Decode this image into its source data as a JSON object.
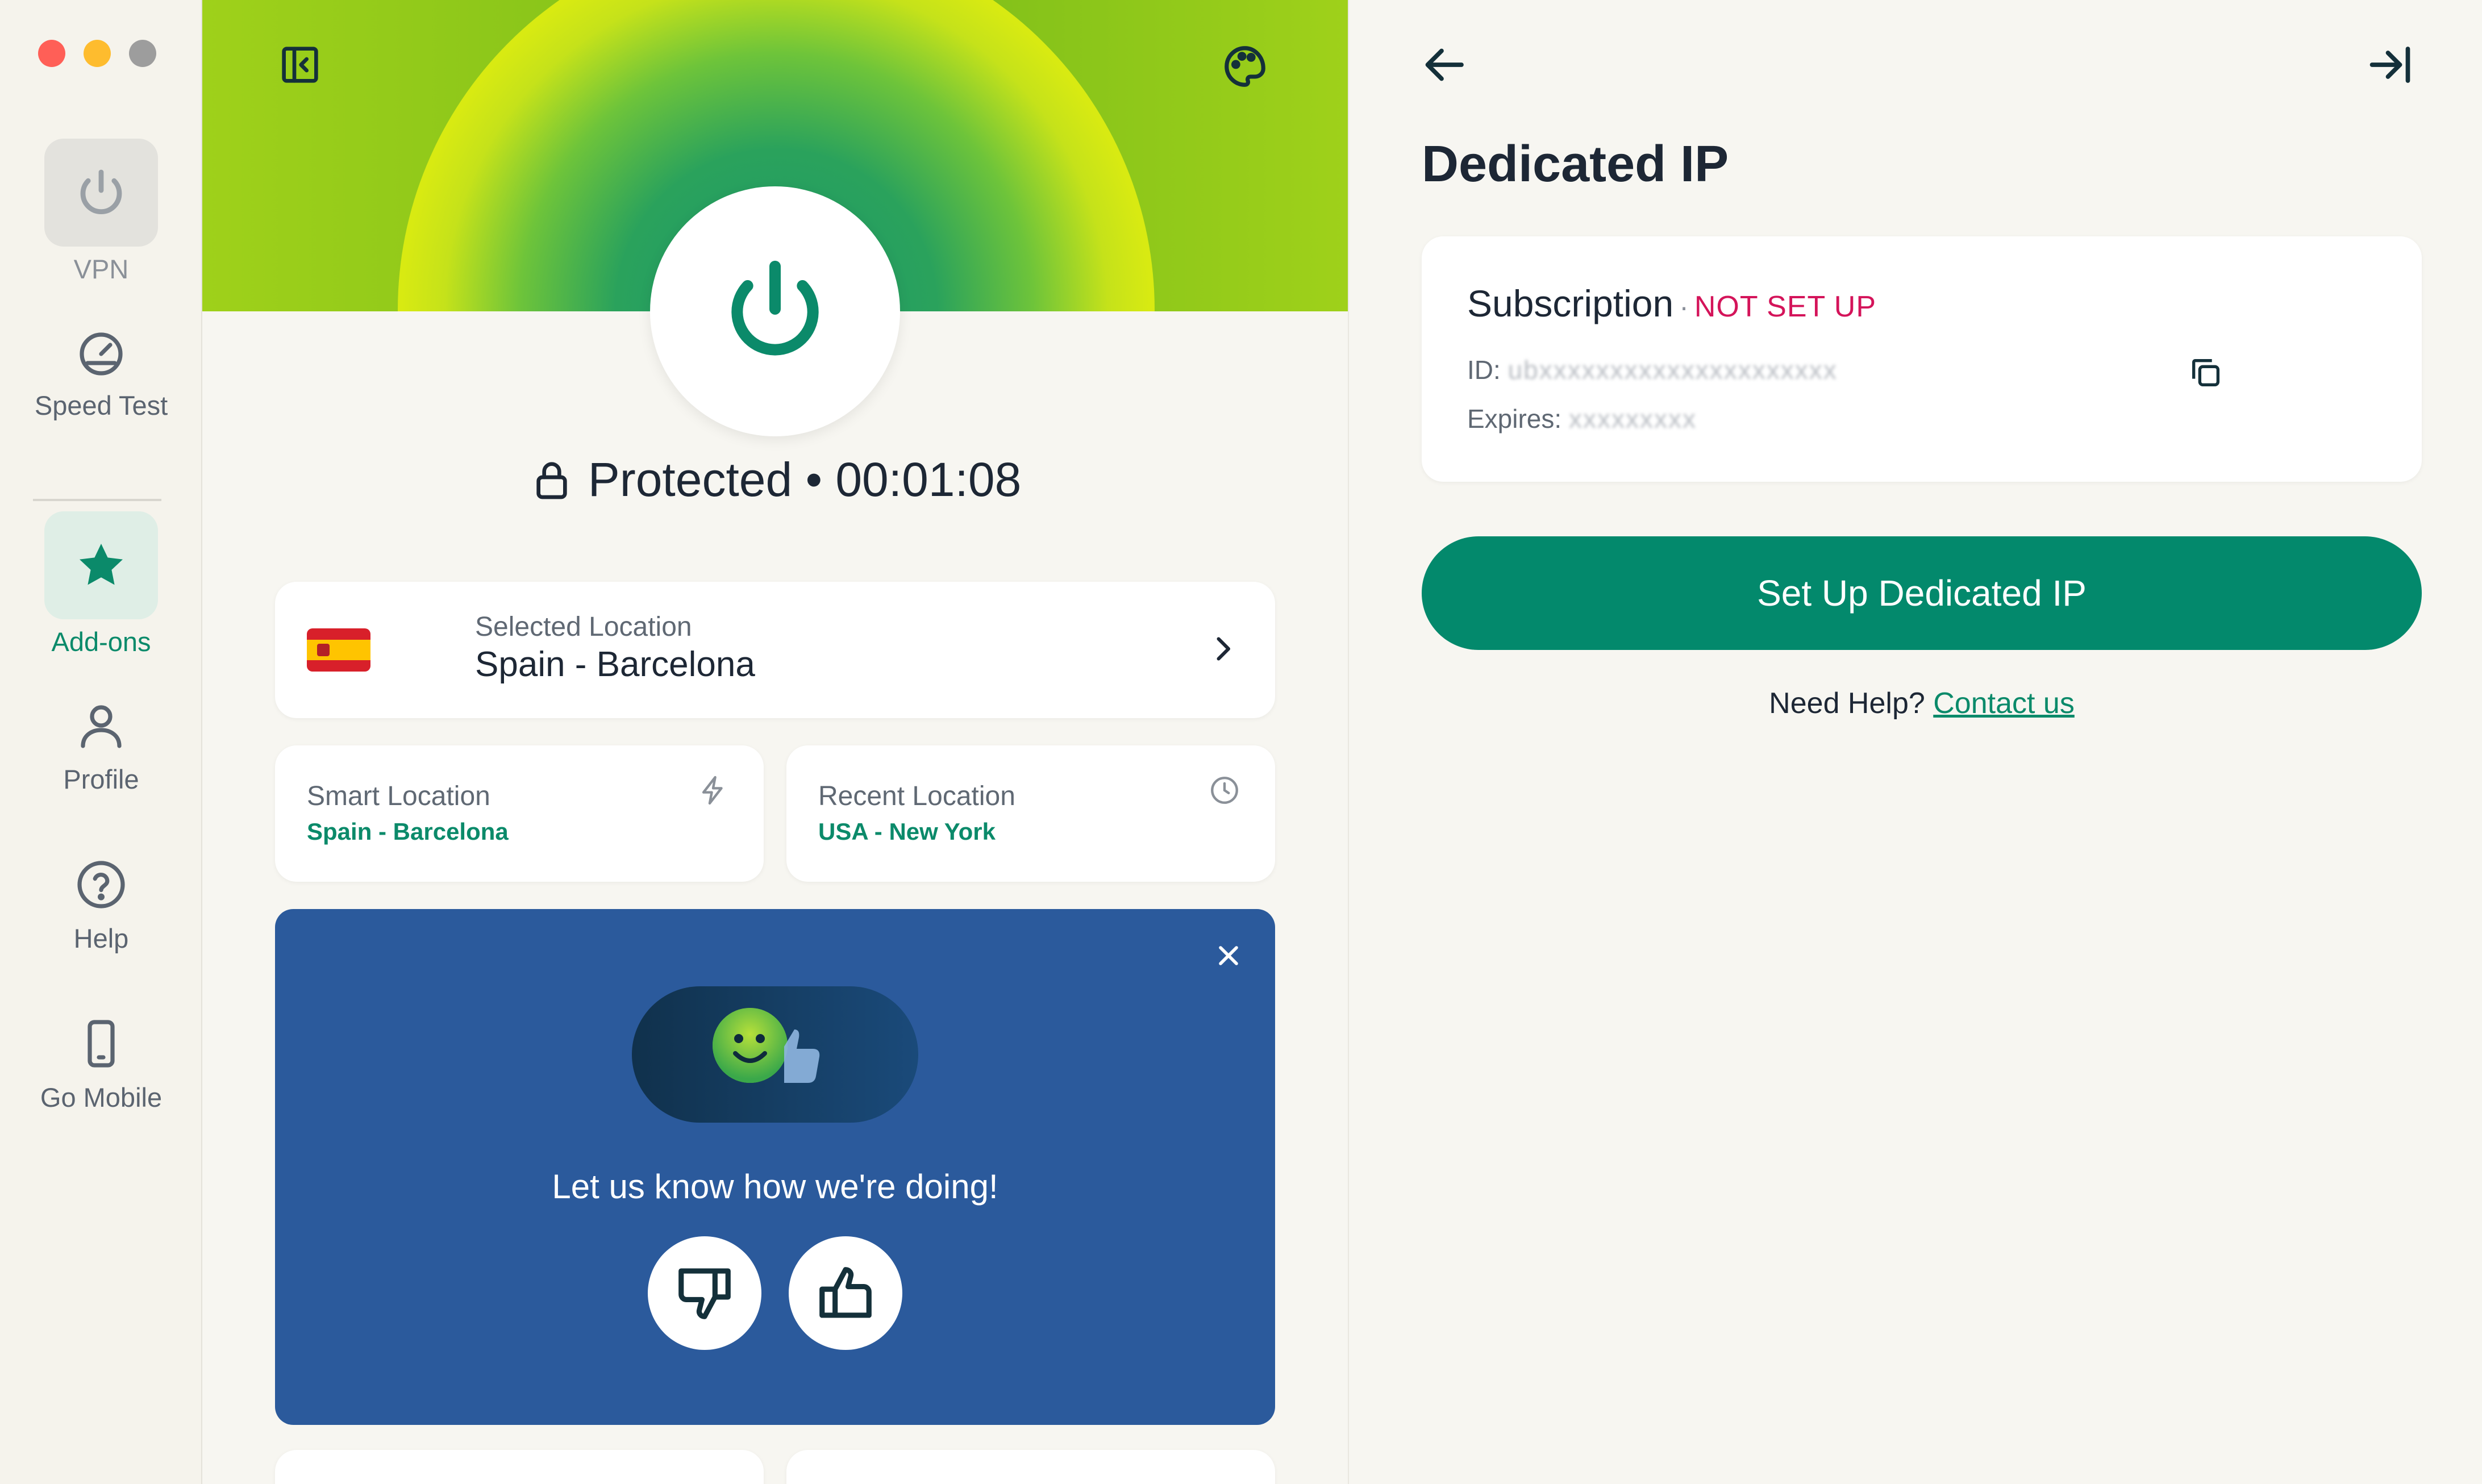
{
  "sidebar": {
    "items": [
      {
        "label": "VPN",
        "icon": "power-icon"
      },
      {
        "label": "Speed Test",
        "icon": "speedometer-icon"
      },
      {
        "label": "Add-ons",
        "icon": "star-icon"
      },
      {
        "label": "Profile",
        "icon": "person-icon"
      },
      {
        "label": "Help",
        "icon": "question-icon"
      },
      {
        "label": "Go Mobile",
        "icon": "phone-icon"
      }
    ]
  },
  "main": {
    "status": "Protected • 00:01:08",
    "selected_location": {
      "label": "Selected Location",
      "value": "Spain - Barcelona"
    },
    "smart_location": {
      "label": "Smart Location",
      "value": "Spain - Barcelona"
    },
    "recent_location": {
      "label": "Recent Location",
      "value": "USA - New York"
    },
    "feedback": {
      "prompt": "Let us know how we're doing!"
    }
  },
  "detail": {
    "title": "Dedicated IP",
    "subscription": {
      "label": "Subscription",
      "separator": "·",
      "status": "NOT SET UP",
      "id_label": "ID:",
      "id_value": "ubxxxxxxxxxxxxxxxxxxxxx",
      "expires_label": "Expires:",
      "expires_value": "xxxxxxxxx"
    },
    "setup_button": "Set Up Dedicated IP",
    "help_text": "Need Help?",
    "help_link": "Contact us"
  },
  "colors": {
    "accent": "#03896c",
    "badge": "#d4145a",
    "feedback_bg": "#2b5a9c"
  }
}
